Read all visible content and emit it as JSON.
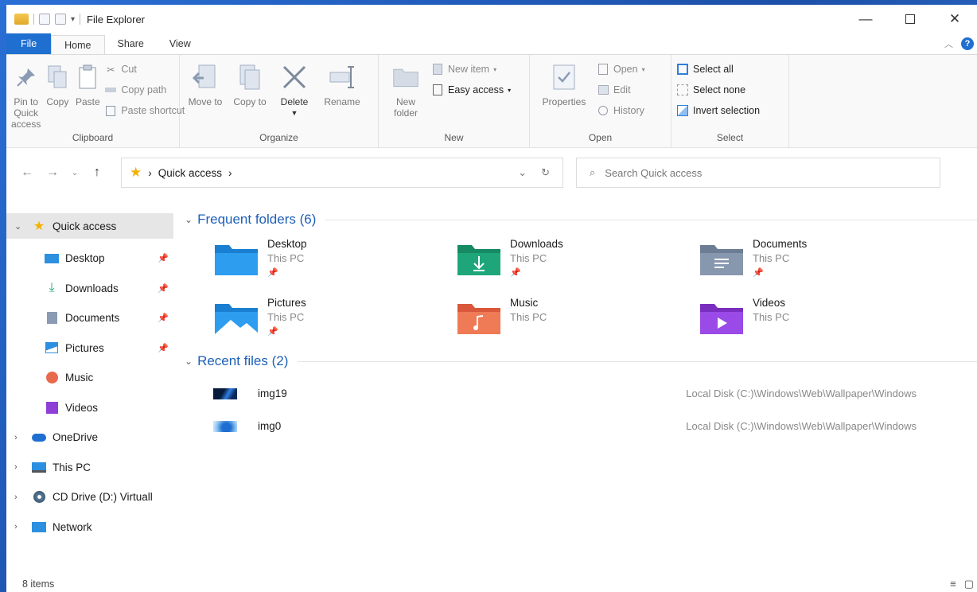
{
  "window": {
    "title": "File Explorer"
  },
  "ribbon_tabs": [
    "File",
    "Home",
    "Share",
    "View"
  ],
  "help_label": "?",
  "ribbon": {
    "clipboard": {
      "label": "Clipboard",
      "pin": "Pin to Quick access",
      "copy": "Copy",
      "paste": "Paste",
      "cut": "Cut",
      "copy_path": "Copy path",
      "paste_shortcut": "Paste shortcut"
    },
    "organize": {
      "label": "Organize",
      "move_to": "Move to",
      "copy_to": "Copy to",
      "delete": "Delete",
      "rename": "Rename"
    },
    "new": {
      "label": "New",
      "new_folder": "New folder",
      "new_item": "New item",
      "easy_access": "Easy access"
    },
    "open": {
      "label": "Open",
      "properties": "Properties",
      "open": "Open",
      "edit": "Edit",
      "history": "History"
    },
    "select": {
      "label": "Select",
      "select_all": "Select all",
      "select_none": "Select none",
      "invert": "Invert selection"
    }
  },
  "address": {
    "location": "Quick access",
    "search_placeholder": "Search Quick access"
  },
  "sidebar": {
    "items": [
      {
        "label": "Quick access"
      },
      {
        "label": "Desktop"
      },
      {
        "label": "Downloads"
      },
      {
        "label": "Documents"
      },
      {
        "label": "Pictures"
      },
      {
        "label": "Music"
      },
      {
        "label": "Videos"
      },
      {
        "label": "OneDrive"
      },
      {
        "label": "This PC"
      },
      {
        "label": "CD Drive (D:) Virtuall"
      },
      {
        "label": "Network"
      }
    ]
  },
  "frequent": {
    "heading": "Frequent folders (6)",
    "folders": [
      {
        "name": "Desktop",
        "location": "This PC",
        "color": "#1a8ad8"
      },
      {
        "name": "Downloads",
        "location": "This PC",
        "color": "#1ea67a"
      },
      {
        "name": "Documents",
        "location": "This PC",
        "color": "#7f8fa6"
      },
      {
        "name": "Pictures",
        "location": "This PC",
        "color": "#2d8fe0"
      },
      {
        "name": "Music",
        "location": "This PC",
        "color": "#e86a4c"
      },
      {
        "name": "Videos",
        "location": "This PC",
        "color": "#8e3fd6"
      }
    ]
  },
  "recent": {
    "heading": "Recent files (2)",
    "files": [
      {
        "name": "img19",
        "path": "Local Disk (C:)\\Windows\\Web\\Wallpaper\\Windows"
      },
      {
        "name": "img0",
        "path": "Local Disk (C:)\\Windows\\Web\\Wallpaper\\Windows"
      }
    ]
  },
  "status": {
    "items": "8 items"
  },
  "colors": {
    "accent": "#1f6fd0",
    "heading": "#1d5fb8",
    "selected": "#e6e6e6"
  }
}
